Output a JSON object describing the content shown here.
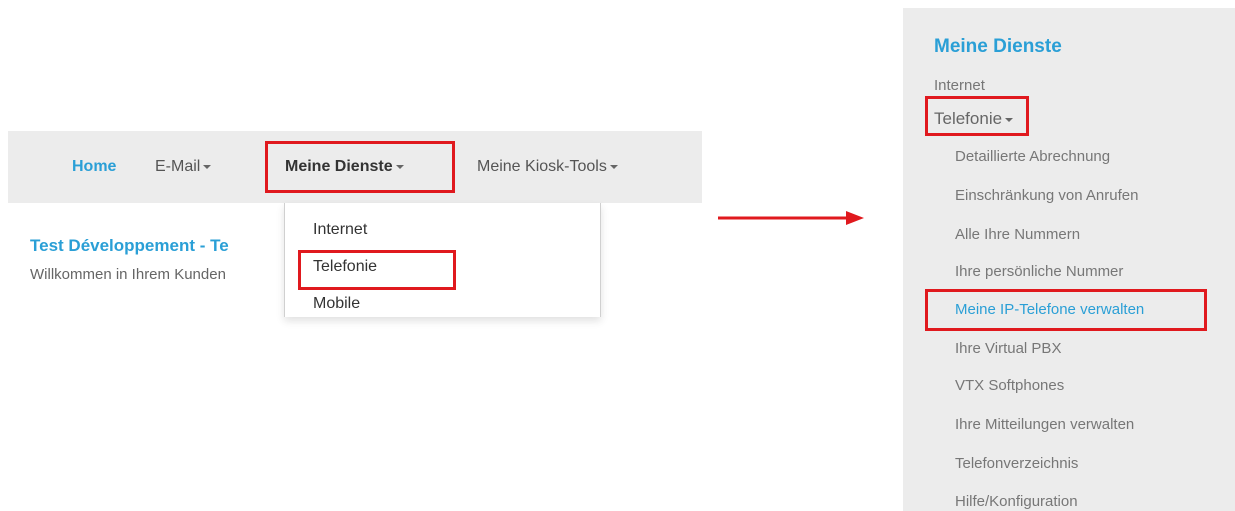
{
  "navbar": {
    "home": "Home",
    "email": "E-Mail",
    "dienste": "Meine Dienste",
    "kiosk": "Meine Kiosk-Tools"
  },
  "dropdown": {
    "items": [
      "Internet",
      "Telefonie",
      "Mobile"
    ]
  },
  "page": {
    "title": "Test Développement - Te",
    "subtitle": "Willkommen in Ihrem Kunden"
  },
  "sidebar": {
    "title": "Meine Dienste",
    "internet": "Internet",
    "telefonie": "Telefonie",
    "sub_items": [
      "Detaillierte Abrechnung",
      "Einschränkung von Anrufen",
      "Alle Ihre Nummern",
      "Ihre persönliche Nummer",
      "Meine IP-Telefone verwalten",
      "Ihre Virtual PBX",
      "VTX Softphones",
      "Ihre Mitteilungen verwalten",
      "Telefonverzeichnis",
      "Hilfe/Konfiguration"
    ]
  },
  "colors": {
    "accent": "#2a9fd6",
    "highlight": "#e0191e",
    "panel": "#ececec"
  }
}
